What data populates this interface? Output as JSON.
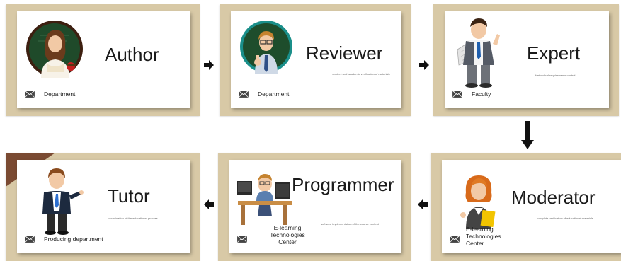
{
  "cards": [
    {
      "title": "Author",
      "desc": "",
      "dept": "Department"
    },
    {
      "title": "Reviewer",
      "desc": "content and academic verification of materials",
      "dept": "Department"
    },
    {
      "title": "Expert",
      "desc": "Methodical requirements control",
      "dept": "Faculty"
    },
    {
      "title": "Moderator",
      "desc": "complete verification of educational materials",
      "dept": "E-learning Technologies Center"
    },
    {
      "title": "Programmer",
      "desc": "software implementation of the course content",
      "dept": "E-learning Technologies Center"
    },
    {
      "title": "Tutor",
      "desc": "coordination of the educational process",
      "dept": "Producing department"
    }
  ],
  "icons": {
    "mail": "envelope-icon",
    "arrow": "arrow-icon",
    "colors": {
      "frame": "#d8c9a6",
      "card": "#ffffff",
      "arrow": "#111111"
    }
  }
}
